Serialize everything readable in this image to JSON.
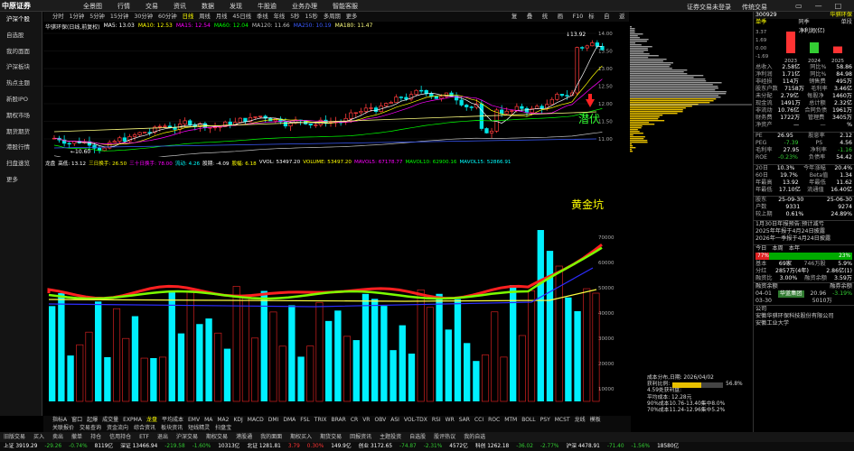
{
  "app": {
    "logo_text": "中原证券",
    "menu": [
      "全景图",
      "行情",
      "交易",
      "资讯",
      "数据",
      "发现",
      "牛股逾",
      "业务办理",
      "智能客服"
    ],
    "login": "证券交易未登录",
    "contact": "传统交易",
    "window_controls": [
      "▭",
      "—",
      "□",
      "✕"
    ]
  },
  "sidebar": [
    "沪深个股",
    "自选股",
    "我的面面",
    "沪深板块",
    "热点主题",
    "新股IPO",
    "期权市场",
    "期货期货",
    "港股行情",
    "扫盘速览",
    "更多"
  ],
  "timeframes": [
    "分时",
    "1分钟",
    "5分钟",
    "15分钟",
    "30分钟",
    "60分钟",
    "日线",
    "周线",
    "月线",
    "45日线",
    "季线",
    "年线",
    "5秒",
    "15秒",
    "多周期",
    "更多"
  ],
  "timeframe_selected": "日线",
  "right_toolbar": [
    "复权",
    "叠加",
    "统计",
    "画线",
    "F10",
    "标记",
    "自选",
    "返回"
  ],
  "chart": {
    "title": "华骐环保(日线,前复权)",
    "ma_legend": [
      {
        "label": "MA5: 13.03",
        "color": "#ffffff"
      },
      {
        "label": "MA10: 12.53",
        "color": "#ffff00"
      },
      {
        "label": "MA15: 12.54",
        "color": "#ff00ff"
      },
      {
        "label": "MA60: 12.04",
        "color": "#00ff00"
      },
      {
        "label": "MA120: 11.66",
        "color": "#c0c0c0"
      },
      {
        "label": "MA250: 10.19",
        "color": "#3b5bff"
      },
      {
        "label": "MA180: 11.47",
        "color": "#ffff80"
      }
    ],
    "high_label": "13.92",
    "low_label": "10.60",
    "annotation_1": "潜伏",
    "annotation_2": "黄金坑"
  },
  "volume_legend": [
    {
      "label": "龙盘",
      "color": "#fff"
    },
    {
      "label": "高低: 13.12",
      "color": "#fff"
    },
    {
      "label": "三日换手: 26.50",
      "color": "#ffff00"
    },
    {
      "label": "三十日换手: 78.00",
      "color": "#ff00ff"
    },
    {
      "label": "流动: 4.26",
      "color": "#00ffff"
    },
    {
      "label": "股期: -4.09",
      "color": "#fff"
    },
    {
      "label": "股幅: 6.18",
      "color": "#ffff00"
    },
    {
      "label": "VVOL: 53497.20",
      "color": "#fff"
    },
    {
      "label": "VOLUME: 53497.20",
      "color": "#ffff00"
    },
    {
      "label": "MAVOL5: 67178.77",
      "color": "#ff00ff"
    },
    {
      "label": "MAVOL10: 62900.16",
      "color": "#00ff00"
    },
    {
      "label": "MAVOL15: 52866.91",
      "color": "#00ffff"
    }
  ],
  "indicator_tabs": [
    "指标A",
    "窗口",
    "起爆",
    "成交量",
    "EXPMA",
    "龙盘",
    "平均成本",
    "EMV",
    "MA",
    "MA2",
    "KDJ",
    "MACD",
    "DMI",
    "DMA",
    "FSL",
    "TRIX",
    "BRAR",
    "CR",
    "VR",
    "OBV",
    "ASI",
    "VOL-TDX",
    "RSI",
    "WR",
    "SAR",
    "CCI",
    "ROC",
    "MTM",
    "BOLL",
    "PSY",
    "MCST",
    "龙线",
    "模板"
  ],
  "indicator_selected": "龙盘",
  "tabs2": [
    "关联报价",
    "交易查询",
    "资金流向",
    "综合资讯",
    "板块资讯",
    "短线精灵",
    "扫盘宝"
  ],
  "bottom_menu": [
    "旧版交易",
    "买入",
    "卖出",
    "撤单",
    "持仓",
    "信用持仓",
    "ETF",
    "退出",
    "沪深交易",
    "期权交易",
    "港股通",
    "我的面面",
    "期权买入",
    "期货交易",
    "回报资讯",
    "主题投资",
    "自选股",
    "股评热议",
    "我的自选"
  ],
  "status": [
    {
      "text": "上证 3919.29",
      "cls": "white"
    },
    {
      "text": "-29.26",
      "cls": "green"
    },
    {
      "text": "-0.74%",
      "cls": "green"
    },
    {
      "text": "8119亿",
      "cls": "white"
    },
    {
      "text": "深证 13466.94",
      "cls": "white"
    },
    {
      "text": "-219.58",
      "cls": "green"
    },
    {
      "text": "-1.60%",
      "cls": "green"
    },
    {
      "text": "10313亿",
      "cls": "white"
    },
    {
      "text": "北证 1281.81",
      "cls": "white"
    },
    {
      "text": "3.79",
      "cls": "red"
    },
    {
      "text": "0.30%",
      "cls": "red"
    },
    {
      "text": "149.9亿",
      "cls": "white"
    },
    {
      "text": "创业 3172.65",
      "cls": "white"
    },
    {
      "text": "-74.87",
      "cls": "green"
    },
    {
      "text": "-2.31%",
      "cls": "green"
    },
    {
      "text": "4572亿",
      "cls": "white"
    },
    {
      "text": "科创 1262.18",
      "cls": "white"
    },
    {
      "text": "-36.02",
      "cls": "green"
    },
    {
      "text": "-2.77%",
      "cls": "green"
    },
    {
      "text": "沪深 4478.91",
      "cls": "white"
    },
    {
      "text": "-71.40",
      "cls": "green"
    },
    {
      "text": "-1.56%",
      "cls": "green"
    },
    {
      "text": "18580亿",
      "cls": "white"
    }
  ],
  "price_axis": [
    "14.00",
    "13.50",
    "13.00",
    "12.50",
    "12.00",
    "11.50",
    "11.00"
  ],
  "vol_axis": [
    "70000",
    "60000",
    "50000",
    "40000",
    "30000",
    "20000",
    "10000"
  ],
  "info_panel": {
    "title": "成本分布,日期: 2026/04/02",
    "profit_label": "获利比例:",
    "profit_value": "56.8%",
    "profit_pct": 56.8,
    "lines": [
      "4.59处获利盘:",
      "平均成本: 12.28元",
      "90%成本10.76-13.40集中8.0%",
      "70%成本11.24-12.96集中5.2%"
    ]
  },
  "right_panel": {
    "code": "300929",
    "name": "华骐环保",
    "tabs": [
      "单季",
      "同季",
      "单段"
    ],
    "profit_label": "净利润(亿)",
    "bars": [
      {
        "year": "2023",
        "value": 3.37,
        "color": "#f33"
      },
      {
        "year": "2024",
        "value": 1.69,
        "color": "#3c3"
      },
      {
        "year": "2025",
        "value": 1.05,
        "color": "#f33"
      }
    ],
    "bar_y_labels": [
      "3.37",
      "1.69",
      "0.00",
      "-1.69"
    ],
    "fundamentals": [
      [
        "总收入",
        "2.58亿",
        "同比%",
        "58.86"
      ],
      [
        "净利润",
        "1.71亿",
        "同比%",
        "84.98"
      ],
      [
        "非经损",
        "114万",
        "销售费",
        "495万"
      ],
      [
        "股东户数",
        "7158万",
        "毛利率",
        "3.46亿"
      ],
      [
        "未分配",
        "2.79亿",
        "每股净",
        "1460万"
      ],
      [
        "现金流",
        "1491万",
        "总计额",
        "2.32亿"
      ],
      [
        "非流动",
        "10.76亿",
        "合同负债",
        "1961万"
      ],
      [
        "财务费",
        "1722万",
        "管理费",
        "3405万"
      ],
      [
        "净资产",
        "—",
        "—",
        "%"
      ]
    ],
    "valuation": [
      [
        "PE",
        "26.95",
        "股息率",
        "2.12"
      ],
      [
        "PEG",
        "-7.39",
        "PS",
        "4.56"
      ],
      [
        "毛利率",
        "27.95",
        "净利率",
        "-1.16"
      ],
      [
        "ROE",
        "-0.23%",
        "负债率",
        "54.42"
      ]
    ],
    "stats": [
      [
        "20日",
        "10.3%",
        "今年涨幅",
        "20.4%"
      ],
      [
        "60日",
        "19.7%",
        "Beta值",
        "1.34"
      ],
      [
        "年最高",
        "13.92",
        "年最低",
        "11.62"
      ],
      [
        "年最低",
        "17.10亿",
        "流通值",
        "16.40亿"
      ]
    ],
    "holders": [
      [
        "股东",
        "25-09-30",
        "",
        "25-06-30"
      ],
      [
        "户数",
        "9331",
        "",
        "9274"
      ],
      [
        "较上期",
        "0.61%",
        "",
        "24.89%"
      ]
    ],
    "events": [
      "1月30日年报预告:预计减亏",
      "2025年年报于4月24日披露",
      "2026年一季报于4月24日披露"
    ],
    "strength_left": "77%",
    "strength_right": "23%",
    "strength_tabs": [
      "今日",
      "本周",
      "本年"
    ],
    "extra": [
      [
        "基本",
        "69家",
        "746万股",
        "5.9%"
      ],
      [
        "分红",
        "2857万(4年)",
        "",
        "2.86亿(1)"
      ],
      [
        "融资比",
        "3.00%",
        "融资余额",
        "3.59万"
      ]
    ],
    "news_head": [
      "融资余额",
      "融券余额"
    ],
    "news_rows": [
      [
        "04-01",
        "华蓝集团",
        "20.96",
        "-3.19%"
      ],
      [
        "03-30",
        "",
        "5010万",
        ""
      ]
    ],
    "company": [
      "公司",
      "安徽华骐环保科技股份有限公司",
      "安徽工业大学"
    ]
  }
}
